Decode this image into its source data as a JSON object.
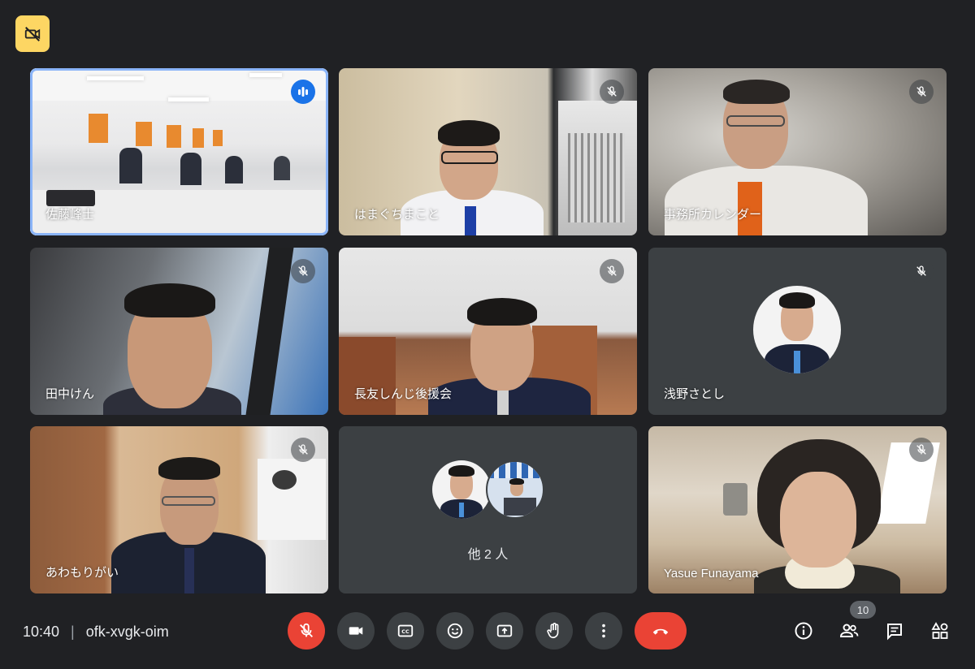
{
  "meeting": {
    "time": "10:40",
    "code": "ofk-xvgk-oim",
    "participant_count": "10"
  },
  "tiles": [
    {
      "name": "佐藤峰士",
      "muted": false,
      "speaking": true
    },
    {
      "name": "はまぐちまこと",
      "muted": true
    },
    {
      "name": "事務所カレンダー",
      "muted": true
    },
    {
      "name": "田中けん",
      "muted": true
    },
    {
      "name": "長友しんじ後援会",
      "muted": true
    },
    {
      "name": "浅野さとし",
      "muted": true,
      "camera_off": true
    },
    {
      "name": "あわもりがい",
      "muted": true
    },
    {
      "name": "",
      "others_label": "他 2 人",
      "camera_off": true
    },
    {
      "name": "Yasue Funayama",
      "muted": true
    }
  ],
  "controls": {
    "mic": "mic-off-icon",
    "camera": "camera-icon",
    "captions": "CC",
    "emoji": "emoji-icon",
    "present": "present-icon",
    "raise_hand": "hand-icon",
    "more": "more-vert-icon",
    "leave": "call-end-icon"
  },
  "side_controls": [
    "info-icon",
    "people-icon",
    "chat-icon",
    "activities-icon"
  ],
  "colors": {
    "background": "#202124",
    "tile_dark": "#3c4043",
    "accent_blue": "#8ab4f8",
    "speaking_blue": "#1a73e8",
    "danger_red": "#ea4335",
    "badge_yellow": "#fdd663"
  }
}
